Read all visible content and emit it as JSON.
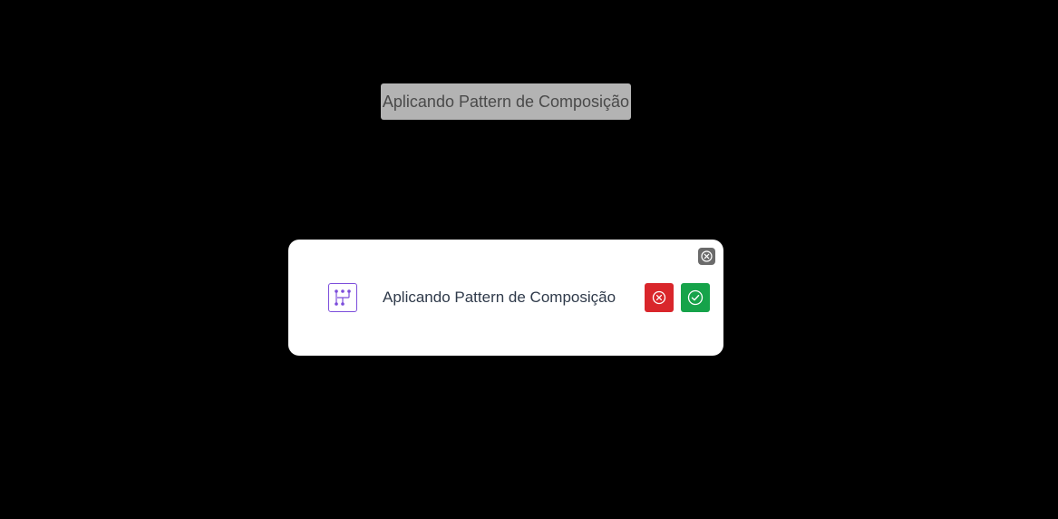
{
  "top_label": {
    "text": "Aplicando Pattern de Composição"
  },
  "dialog": {
    "title": "Aplicando Pattern de Composição",
    "icon": "pattern-composition-icon",
    "close_icon": "close-circle-icon",
    "cancel_icon": "x-circle-icon",
    "confirm_icon": "check-circle-icon"
  },
  "colors": {
    "background": "#000000",
    "top_label_bg": "#b3b3b3",
    "cancel": "#d9262b",
    "confirm": "#16a34a",
    "icon_accent": "#7c4ddb",
    "close_bg": "#6b6b6b"
  }
}
